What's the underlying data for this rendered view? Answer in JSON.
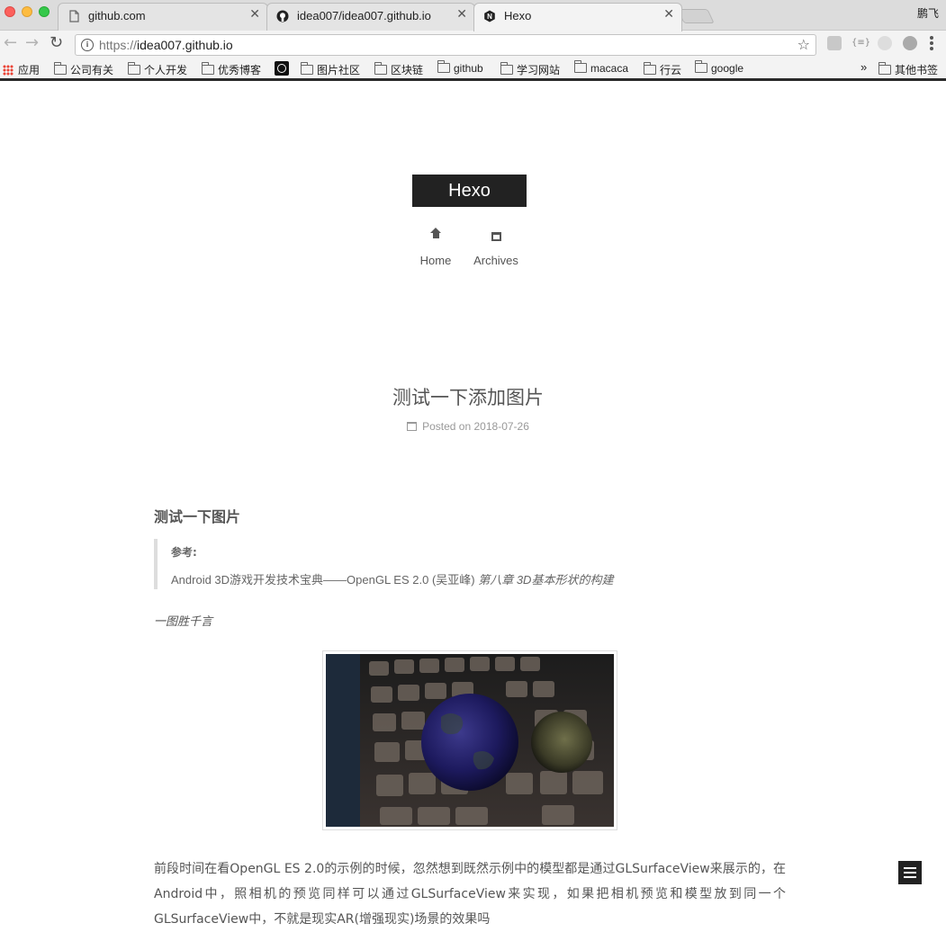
{
  "browser": {
    "tabs": [
      {
        "title": "github.com",
        "icon": "page-icon",
        "active": false
      },
      {
        "title": "idea007/idea007.github.io",
        "icon": "github-icon",
        "active": false
      },
      {
        "title": "Hexo",
        "icon": "hexo-icon",
        "active": true
      }
    ],
    "user_label": "鹏飞",
    "url_scheme": "https://",
    "url_host": "idea007.github.io",
    "bookmarks": [
      "应用",
      "公司有关",
      "个人开发",
      "优秀博客",
      "图片社区",
      "区块链",
      "github",
      "学习网站",
      "macaca",
      "行云",
      "google"
    ],
    "overflow_label": "»",
    "other_bookmarks": "其他书签"
  },
  "site": {
    "title": "Hexo",
    "menu": [
      {
        "label": "Home",
        "icon": "home-icon"
      },
      {
        "label": "Archives",
        "icon": "archive-icon"
      }
    ]
  },
  "post": {
    "title": "测试一下添加图片",
    "meta_prefix": "Posted on",
    "date": "2018-07-26",
    "heading": "测试一下图片",
    "quote_label": "参考:",
    "quote_text": "Android 3D游戏开发技术宝典——OpenGL ES 2.0 (吴亚峰) ",
    "quote_emphasis": "第八章 3D基本形状的构建",
    "lead": "一图胜千言",
    "image_alt": "earth-and-moon-over-keyboard",
    "paragraph": "前段时间在看OpenGL ES 2.0的示例的时候，忽然想到既然示例中的模型都是通过GLSurfaceView来展示的，在Android中，照相机的预览同样可以通过GLSurfaceView来实现，如果把相机预览和模型放到同一个GLSurfaceView中，不就是现实AR(增强现实)场景的效果吗"
  },
  "colors": {
    "brand_bg": "#222222",
    "text": "#555555",
    "meta": "#999999"
  }
}
